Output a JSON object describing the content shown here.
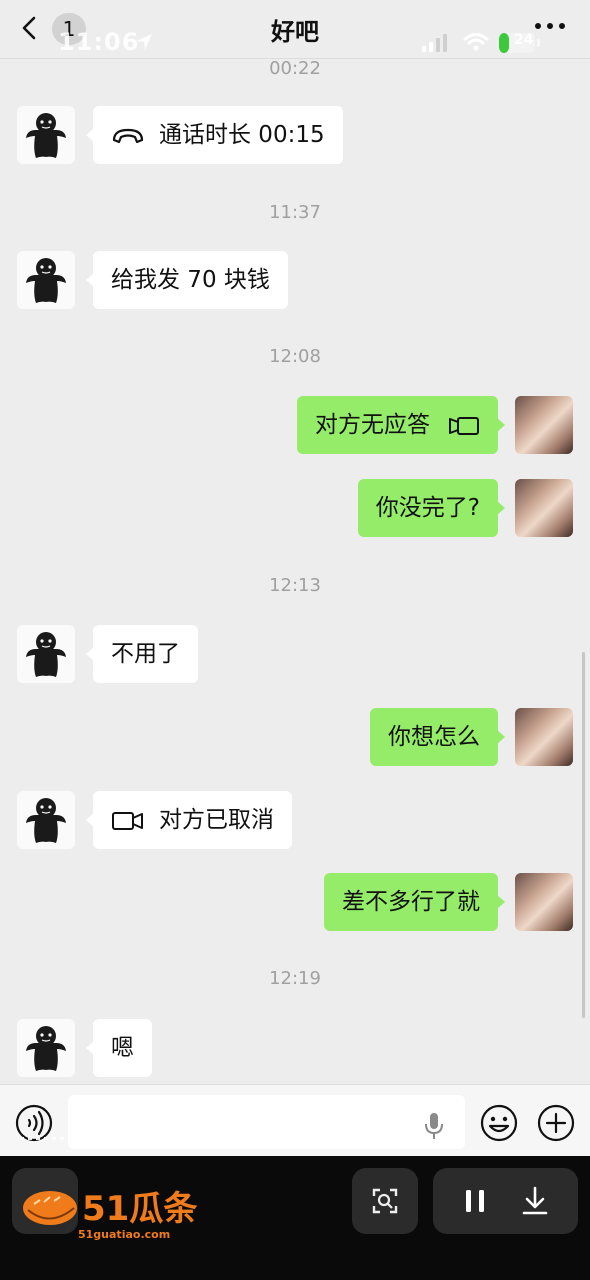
{
  "status": {
    "time": "11:06",
    "battery": "24"
  },
  "header": {
    "back_count": "1",
    "title": "好吧"
  },
  "messages": [
    {
      "type": "timestamp",
      "text": "00:22"
    },
    {
      "type": "in",
      "icon": "phone-icon",
      "text": "通话时长 00:15"
    },
    {
      "type": "timestamp",
      "text": "11:37"
    },
    {
      "type": "in",
      "text": "给我发 70 块钱"
    },
    {
      "type": "timestamp",
      "text": "12:08"
    },
    {
      "type": "out",
      "icon": "video-call-icon",
      "text": "对方无应答"
    },
    {
      "type": "out",
      "text": "你没完了?"
    },
    {
      "type": "timestamp",
      "text": "12:13"
    },
    {
      "type": "in",
      "text": "不用了"
    },
    {
      "type": "out",
      "text": "你想怎么"
    },
    {
      "type": "in",
      "icon": "video-call-icon",
      "text": "对方已取消"
    },
    {
      "type": "out",
      "text": "差不多行了就"
    },
    {
      "type": "timestamp",
      "text": "12:19"
    },
    {
      "type": "in",
      "text": "嗯"
    }
  ],
  "input": {
    "placeholder": ""
  },
  "watermark": {
    "brand": "51瓜条",
    "domain": "51guatiao.com"
  },
  "colors": {
    "outgoing_bubble": "#95ec69",
    "incoming_bubble": "#ffffff",
    "background": "#ededed",
    "player_bar": "#0a0a0a"
  }
}
